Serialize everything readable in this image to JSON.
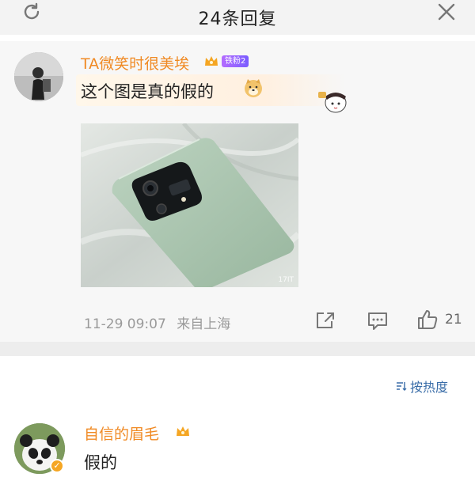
{
  "header": {
    "title": "24条回复",
    "refresh_icon": "refresh-icon",
    "close_icon": "close-icon"
  },
  "main_comment": {
    "username": "TA微笑时很美埃",
    "level_badge": "铁粉2",
    "text": "这个图是真的假的",
    "image_watermark": "17IT",
    "time": "11-29 09:07",
    "location": "来自上海",
    "like_count": "21",
    "colors": {
      "username": "#f08a24",
      "phone": "#a7c2ab"
    }
  },
  "sort": {
    "label": "按热度"
  },
  "reply": {
    "username": "自信的眉毛",
    "text": "假的",
    "badge_icon": "verified-icon"
  }
}
